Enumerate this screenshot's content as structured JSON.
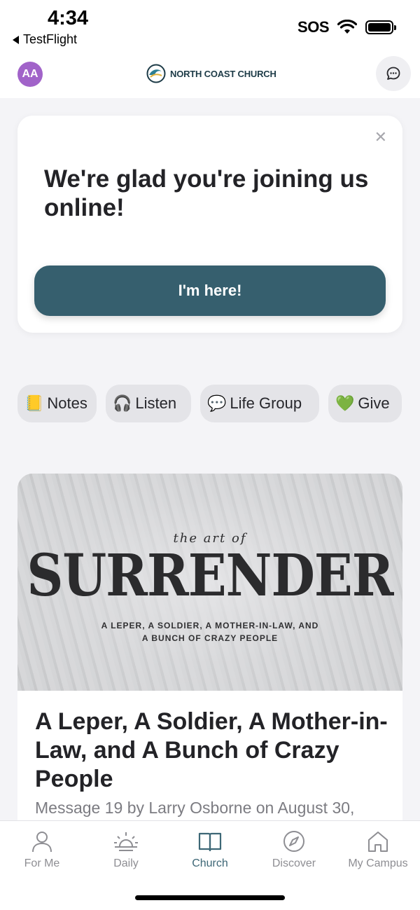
{
  "status_bar": {
    "time": "4:34",
    "back_app": "TestFlight",
    "sos": "SOS"
  },
  "header": {
    "avatar_initials": "AA",
    "logo_text": "NORTH COAST CHURCH",
    "avatar_color": "#a163c9",
    "brand_color": "#365f6e"
  },
  "welcome_card": {
    "title": "We're glad you're joining us online!",
    "close_icon": "close-icon",
    "button_label": "I'm here!"
  },
  "quick_actions": [
    {
      "emoji": "📒",
      "label": "Notes"
    },
    {
      "emoji": "🎧",
      "label": "Listen"
    },
    {
      "emoji": "💬",
      "label": "Life Group"
    },
    {
      "emoji": "💚",
      "label": "Give"
    }
  ],
  "sermon": {
    "art": {
      "small_text": "the art of",
      "big_text": "SURRENDER",
      "subtitle_line1": "A LEPER, A SOLDIER, A MOTHER-IN-LAW, AND",
      "subtitle_line2": "A BUNCH OF CRAZY PEOPLE"
    },
    "title": "A Leper, A Soldier, A Mother-in-Law, and A Bunch of Crazy People",
    "meta": "Message 19 by Larry Osborne on August 30,"
  },
  "tabs": [
    {
      "label": "For Me",
      "icon": "person-icon",
      "active": false
    },
    {
      "label": "Daily",
      "icon": "sunrise-icon",
      "active": false
    },
    {
      "label": "Church",
      "icon": "book-icon",
      "active": true
    },
    {
      "label": "Discover",
      "icon": "compass-icon",
      "active": false
    },
    {
      "label": "My Campus",
      "icon": "home-icon",
      "active": false
    }
  ]
}
